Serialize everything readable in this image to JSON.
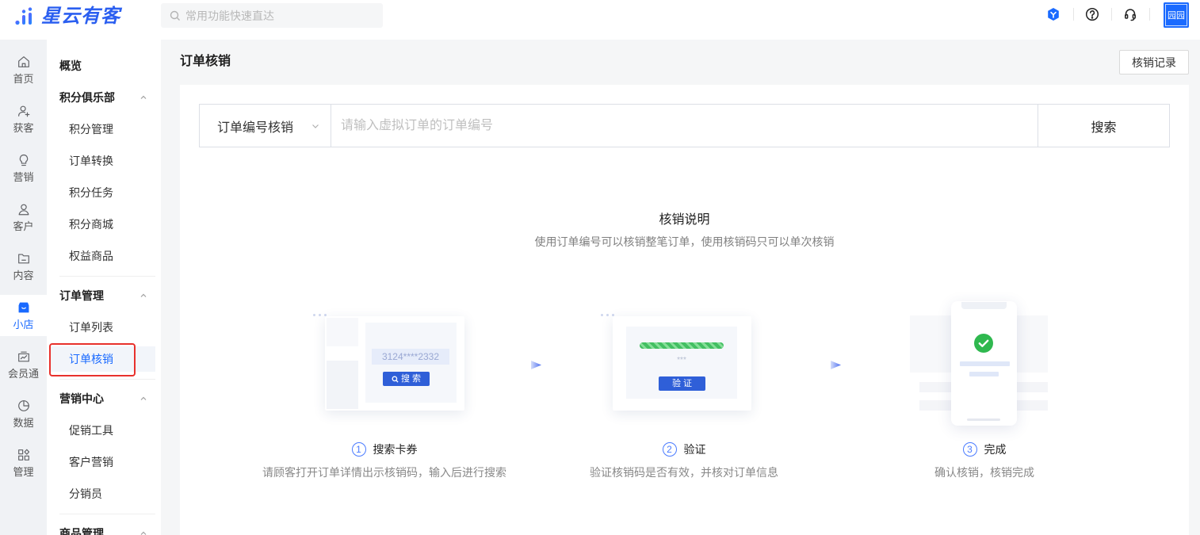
{
  "header": {
    "logo_text": "星云有客",
    "search_placeholder": "常用功能快速直达",
    "icons": [
      "verified-badge-icon",
      "help-icon",
      "headset-icon"
    ],
    "avatar_text": "园园"
  },
  "rail": {
    "items": [
      {
        "label": "首页",
        "icon": "home-icon",
        "active": false
      },
      {
        "label": "获客",
        "icon": "user-add-icon",
        "active": false
      },
      {
        "label": "营销",
        "icon": "bulb-icon",
        "active": false
      },
      {
        "label": "客户",
        "icon": "user-icon",
        "active": false
      },
      {
        "label": "内容",
        "icon": "folder-icon",
        "active": false
      },
      {
        "label": "小店",
        "icon": "shop-icon",
        "active": true
      },
      {
        "label": "会员通",
        "icon": "member-icon",
        "active": false
      },
      {
        "label": "数据",
        "icon": "pie-chart-icon",
        "active": false
      },
      {
        "label": "管理",
        "icon": "grid-icon",
        "active": false
      }
    ]
  },
  "sidebar": {
    "overview": "概览",
    "groups": [
      {
        "title": "积分俱乐部",
        "expanded": true,
        "items": [
          {
            "label": "积分管理",
            "active": false
          },
          {
            "label": "订单转换",
            "active": false
          },
          {
            "label": "积分任务",
            "active": false
          },
          {
            "label": "积分商城",
            "active": false
          },
          {
            "label": "权益商品",
            "active": false
          }
        ]
      },
      {
        "title": "订单管理",
        "expanded": true,
        "items": [
          {
            "label": "订单列表",
            "active": false
          },
          {
            "label": "订单核销",
            "active": true
          }
        ]
      },
      {
        "title": "营销中心",
        "expanded": true,
        "items": [
          {
            "label": "促销工具",
            "active": false
          },
          {
            "label": "客户营销",
            "active": false
          },
          {
            "label": "分销员",
            "active": false
          }
        ]
      },
      {
        "title": "商品管理",
        "expanded": true,
        "items": []
      }
    ]
  },
  "page": {
    "title": "订单核销",
    "records_button": "核销记录",
    "search": {
      "mode": "订单编号核销",
      "placeholder": "请输入虚拟订单的订单编号",
      "button": "搜索"
    },
    "guide": {
      "title": "核销说明",
      "subtitle": "使用订单编号可以核销整笔订单，使用核销码只可以单次核销",
      "steps": [
        {
          "number": "1",
          "title": "搜索卡券",
          "desc": "请顾客打开订单详情出示核销码，输入后进行搜索"
        },
        {
          "number": "2",
          "title": "验证",
          "desc": "验证核销码是否有效，并核对订单信息"
        },
        {
          "number": "3",
          "title": "完成",
          "desc": "确认核销，核销完成"
        }
      ]
    },
    "illustrations": {
      "search_code": "3124****2332",
      "search_button": "搜 索",
      "verify_mask": "***",
      "verify_button": "验 证"
    }
  },
  "colors": {
    "accent": "#1a6aff",
    "highlight_border": "#e8312c",
    "success": "#2fb84f"
  }
}
